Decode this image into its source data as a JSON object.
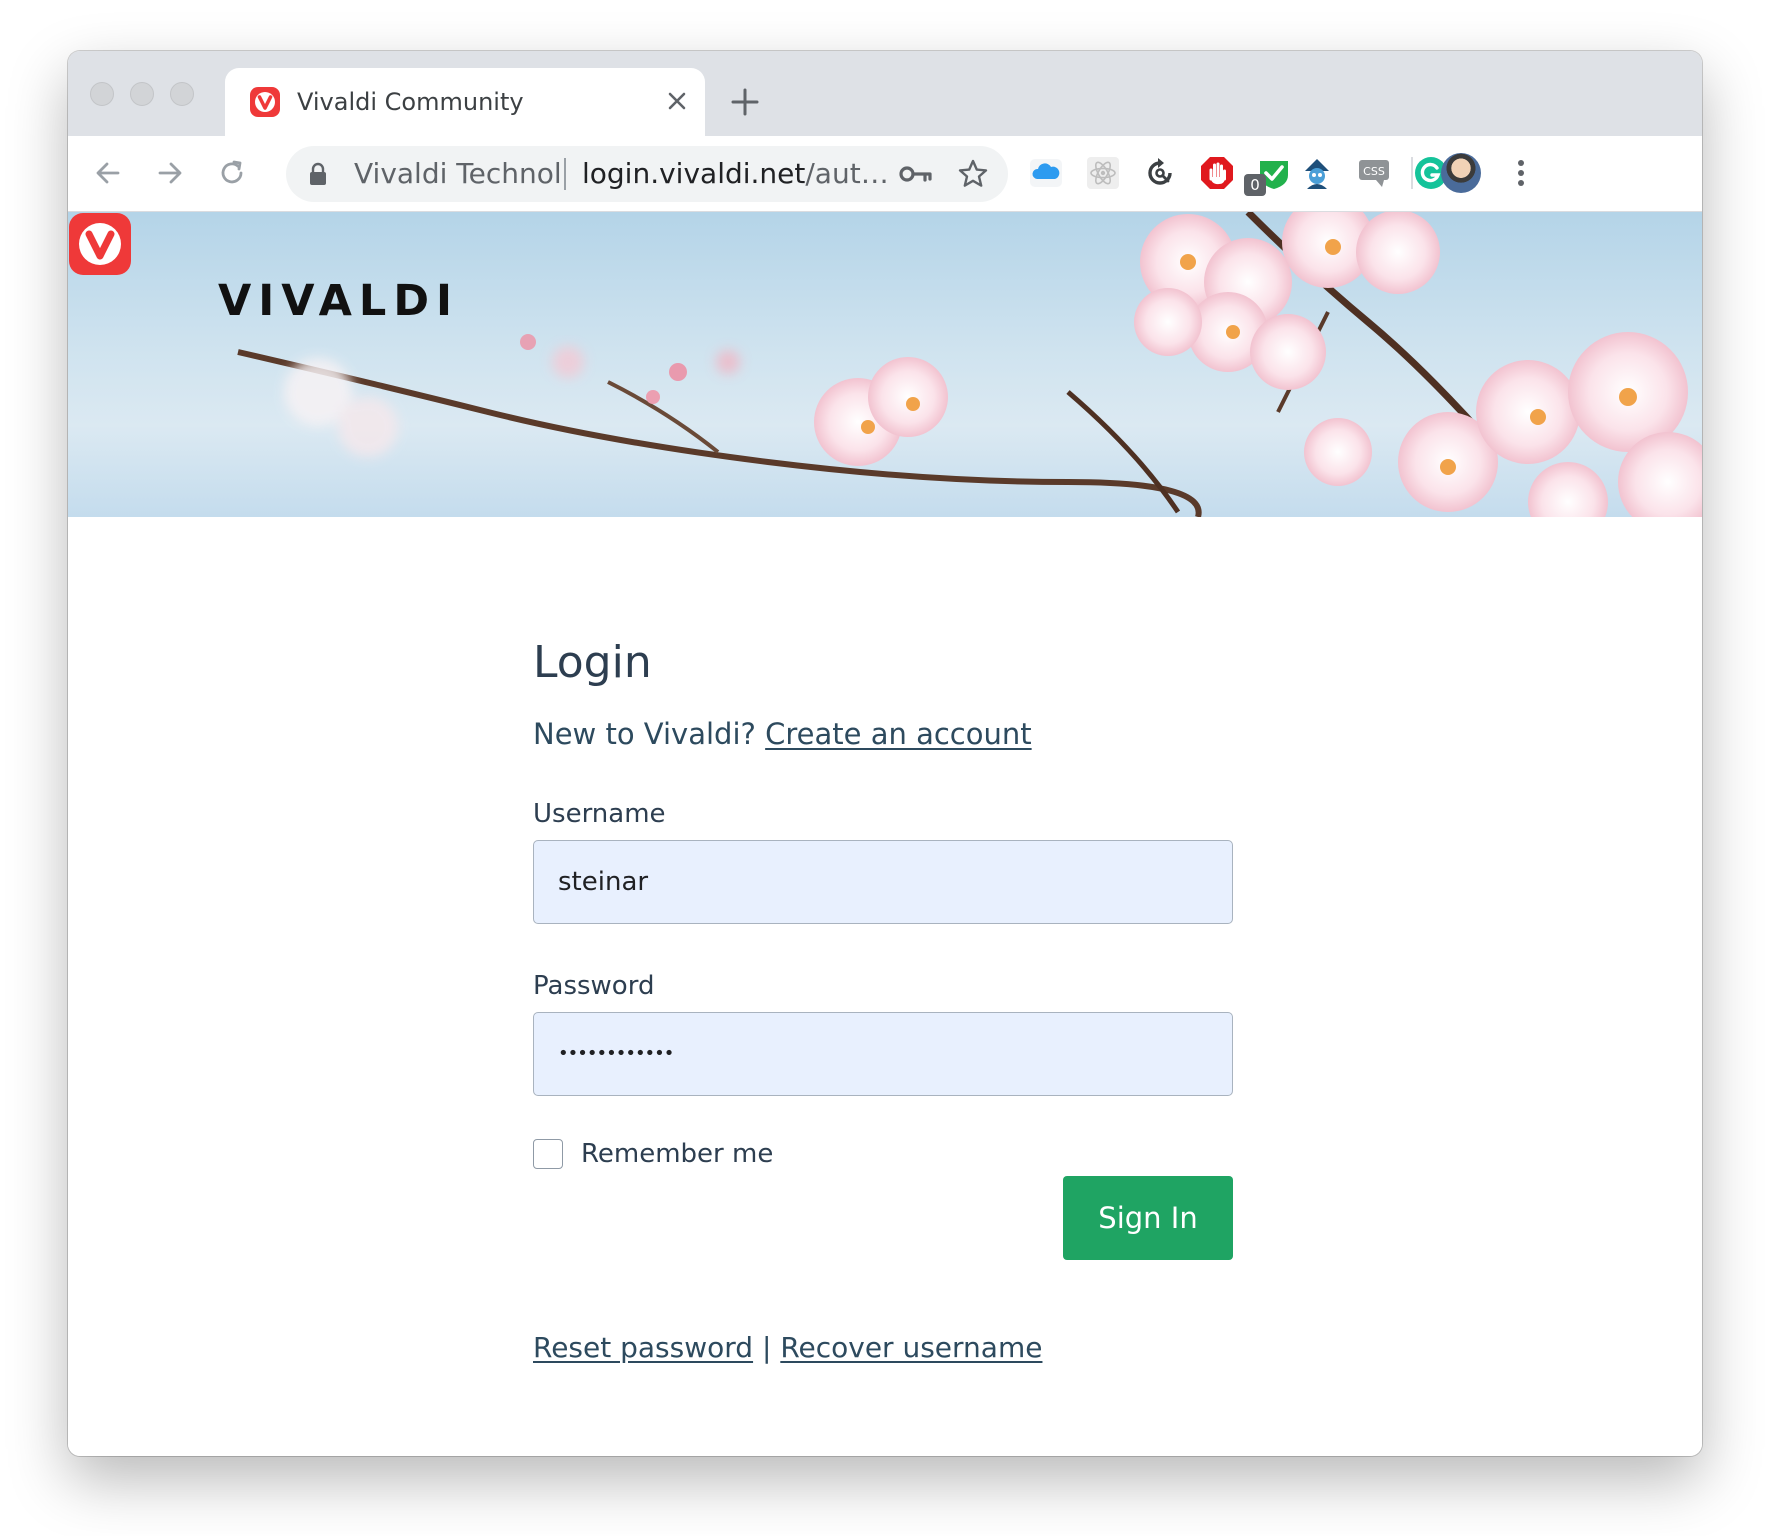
{
  "browser": {
    "tab": {
      "title": "Vivaldi Community",
      "favicon": "vivaldi-logo-icon"
    },
    "toolbar": {
      "back_icon": "arrow-left-icon",
      "forward_icon": "arrow-right-icon",
      "reload_icon": "reload-icon",
      "site_name": "Vivaldi Technol",
      "url_host": "login.vivaldi.net",
      "url_path": "/aut…",
      "extensions": [
        "icloud-icon",
        "react-devtools-icon",
        "sync-icon",
        "adblock-hand-icon",
        "checkmark-extension-icon",
        "wizard-icon",
        "css-viewer-icon",
        "grammarly-icon"
      ],
      "extension_badge": "0"
    }
  },
  "hero": {
    "brand": "VIVALDI"
  },
  "login": {
    "title": "Login",
    "new_prompt": "New to Vivaldi?",
    "create_link": "Create an account",
    "username_label": "Username",
    "username_value": "steinar",
    "password_label": "Password",
    "password_value": "••••••••••••",
    "remember_label": "Remember me",
    "remember_checked": false,
    "signin_label": "Sign In",
    "reset_link": "Reset password",
    "separator": "|",
    "recover_link": "Recover username"
  },
  "colors": {
    "accent_green": "#1fa463",
    "vivaldi_red": "#ef3939",
    "field_bg": "#e8f0fe",
    "link_color": "#2d4a5e"
  }
}
